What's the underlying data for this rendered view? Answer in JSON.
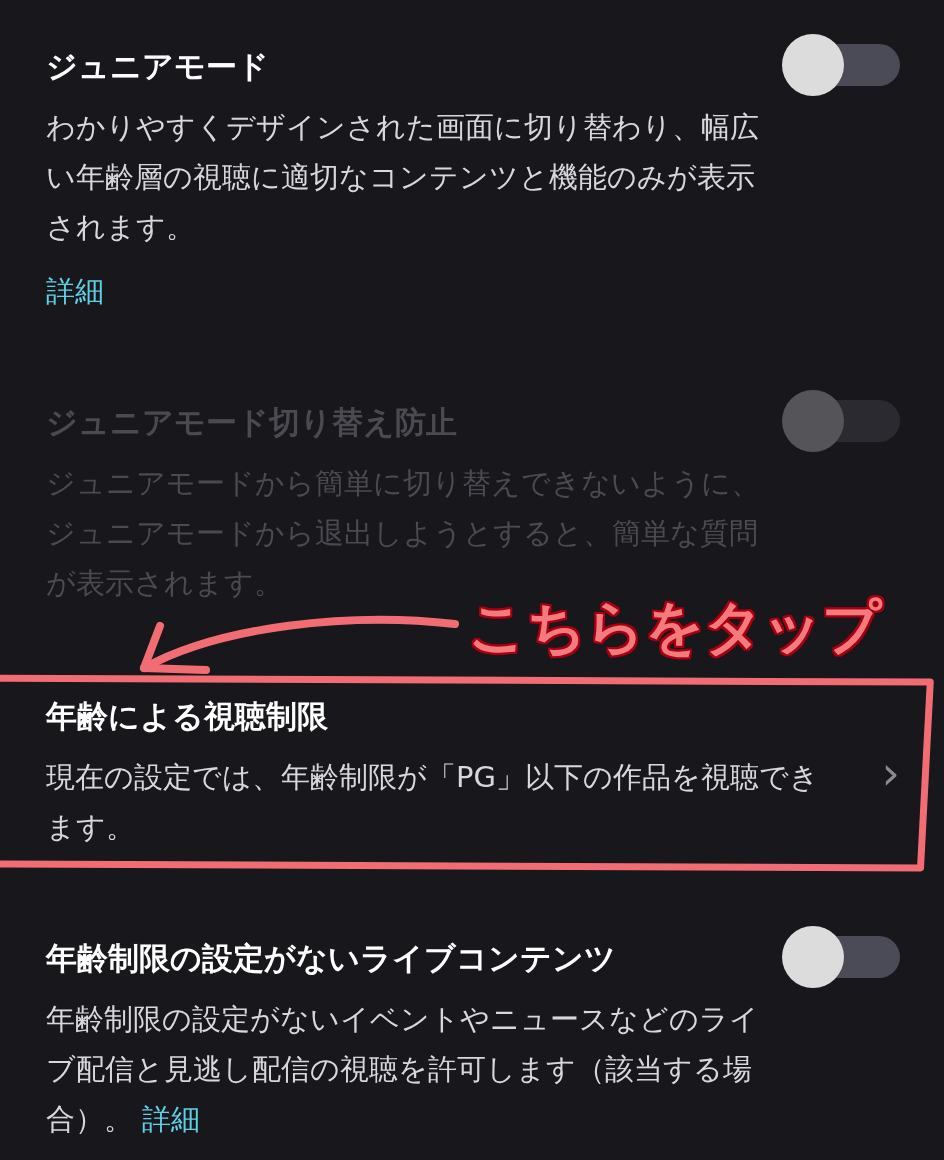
{
  "settings": [
    {
      "kind": "toggle",
      "title": "ジュニアモード",
      "description": "わかりやすくデザインされた画面に切り替わり、幅広い年齢層の視聴に適切なコンテンツと機能のみが表示されます。",
      "link": "詳細",
      "on": false,
      "disabled": false
    },
    {
      "kind": "toggle",
      "title": "ジュニアモード切り替え防止",
      "description": "ジュニアモードから簡単に切り替えできないように、ジュニアモードから退出しようとすると、簡単な質問が表示されます。",
      "on": false,
      "disabled": true
    },
    {
      "kind": "link",
      "title": "年齢による視聴制限",
      "description": "現在の設定では、年齢制限が「PG」以下の作品を視聴できます。",
      "chevron": "›",
      "highlighted": true
    },
    {
      "kind": "toggle",
      "title": "年齢制限の設定がないライブコンテンツ",
      "description": "年齢制限の設定がないイベントやニュースなどのライブ配信と見逃し配信の視聴を許可します（該当する場合）。",
      "inline_link": "詳細",
      "on": false,
      "disabled": false
    }
  ],
  "annotation": {
    "label": "こちらをタップ"
  }
}
